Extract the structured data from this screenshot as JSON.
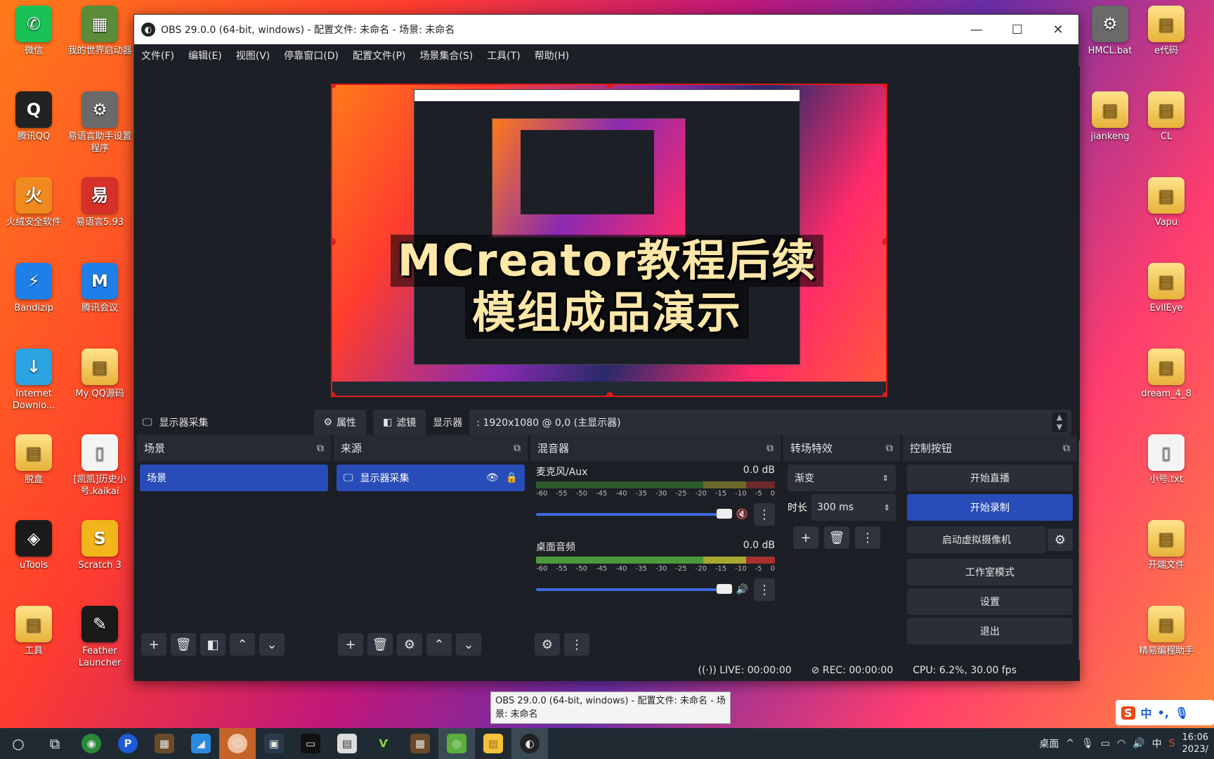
{
  "desktop_left": [
    {
      "label": "微信",
      "glyph": "✆",
      "cls": "green"
    },
    {
      "label": "腾讯QQ",
      "glyph": "Q",
      "cls": "qq"
    },
    {
      "label": "火绒安全软件",
      "glyph": "火",
      "cls": "orange"
    },
    {
      "label": "Bandizip",
      "glyph": "⚡",
      "cls": "blue"
    },
    {
      "label": "Internet Downlo...",
      "glyph": "↓",
      "cls": "teal"
    },
    {
      "label": "脱盒",
      "glyph": "▤",
      "cls": "folder"
    },
    {
      "label": "uTools",
      "glyph": "◈",
      "cls": "dark"
    },
    {
      "label": "工具",
      "glyph": "▤",
      "cls": "folder"
    }
  ],
  "desktop_left2": [
    {
      "label": "我的世界启动器",
      "glyph": "▦",
      "cls": "mc"
    },
    {
      "label": "易语言助手设置程序",
      "glyph": "⚙",
      "cls": "gray"
    },
    {
      "label": "易语言5.93",
      "glyph": "易",
      "cls": "red"
    },
    {
      "label": "腾讯会议",
      "glyph": "M",
      "cls": "blue"
    },
    {
      "label": "My QQ源码",
      "glyph": "▤",
      "cls": "folder"
    },
    {
      "label": "[凯凯]历史小号.kaikai",
      "glyph": "▯",
      "cls": "file"
    },
    {
      "label": "Scratch 3",
      "glyph": "S",
      "cls": "yellow"
    },
    {
      "label": "Feather Launcher",
      "glyph": "✎",
      "cls": "dark"
    }
  ],
  "desktop_right": [
    {
      "label": "HMCL.bat",
      "glyph": "⚙",
      "cls": "gray"
    },
    {
      "label": "jiankeng",
      "glyph": "▤",
      "cls": "folder"
    },
    {
      "label": "",
      "glyph": "",
      "cls": ""
    },
    {
      "label": "",
      "glyph": "",
      "cls": ""
    },
    {
      "label": "",
      "glyph": "",
      "cls": ""
    },
    {
      "label": "",
      "glyph": "",
      "cls": ""
    },
    {
      "label": "",
      "glyph": "",
      "cls": ""
    }
  ],
  "desktop_right2": [
    {
      "label": "e代码",
      "glyph": "▤",
      "cls": "folder"
    },
    {
      "label": "CL",
      "glyph": "▤",
      "cls": "folder"
    },
    {
      "label": "Vapu",
      "glyph": "▤",
      "cls": "folder"
    },
    {
      "label": "EvilEye",
      "glyph": "▤",
      "cls": "folder"
    },
    {
      "label": "dream_4_8",
      "glyph": "▤",
      "cls": "folder"
    },
    {
      "label": "小号.txt",
      "glyph": "▯",
      "cls": "file"
    },
    {
      "label": "开端文件",
      "glyph": "▤",
      "cls": "folder"
    },
    {
      "label": "精易编程助手",
      "glyph": "▤",
      "cls": "folder"
    }
  ],
  "obs": {
    "title": "OBS 29.0.0 (64-bit, windows) - 配置文件: 未命名 - 场景: 未命名",
    "menu": [
      "文件(F)",
      "编辑(E)",
      "视图(V)",
      "停靠窗口(D)",
      "配置文件(P)",
      "场景集合(S)",
      "工具(T)",
      "帮助(H)"
    ],
    "overlay_line1": "MCreator教程后续",
    "overlay_line2": "模组成品演示",
    "source_name": "显示器采集",
    "properties_label": "属性",
    "filters_label": "滤镜",
    "display_label": "显示器",
    "display_value": ": 1920x1080 @ 0,0 (主显示器)",
    "scenes": {
      "title": "场景",
      "items": [
        "场景"
      ]
    },
    "sources": {
      "title": "来源",
      "items": [
        "显示器采集"
      ]
    },
    "mixer": {
      "title": "混音器",
      "channels": [
        {
          "name": "麦克风/Aux",
          "db": "0.0 dB"
        },
        {
          "name": "桌面音频",
          "db": "0.0 dB"
        }
      ],
      "ticks": [
        "-60",
        "-55",
        "-50",
        "-45",
        "-40",
        "-35",
        "-30",
        "-25",
        "-20",
        "-15",
        "-10",
        "-5",
        "0"
      ]
    },
    "transitions": {
      "title": "转场特效",
      "type": "渐变",
      "duration_label": "时长",
      "duration": "300 ms"
    },
    "controls": {
      "title": "控制按钮",
      "stream": "开始直播",
      "record": "开始录制",
      "virtualcam": "启动虚拟摄像机",
      "studio": "工作室模式",
      "settings": "设置",
      "exit": "退出"
    },
    "status": {
      "live": "LIVE: 00:00:00",
      "rec": "REC: 00:00:00",
      "cpu": "CPU: 6.2%, 30.00 fps"
    }
  },
  "tooltip": "OBS 29.0.0 (64-bit, windows) - 配置文件: 未命名 - 场景: 未命名",
  "taskbar": {
    "desktop_label": "桌面",
    "ime_lang": "中",
    "clock_time": "16:06",
    "clock_date": "2023/"
  }
}
